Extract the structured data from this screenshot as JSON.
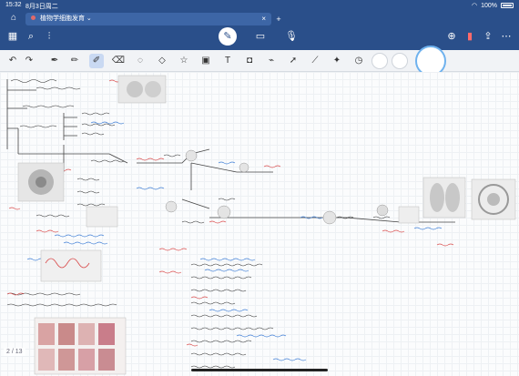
{
  "status": {
    "time": "15:32",
    "date": "8月3日周二",
    "battery": "100%"
  },
  "document": {
    "title": "植物学细胞发育",
    "page_indicator": "2 / 13"
  },
  "toolbar": {
    "left": [
      "grid-icon",
      "search-icon",
      "audio-icon"
    ],
    "center": [
      "pen-edit-icon",
      "keyboard-icon",
      "mic-icon"
    ],
    "right": [
      "add-page-icon",
      "bookmark-icon",
      "share-icon",
      "more-icon"
    ]
  },
  "pen_tools": [
    "undo-icon",
    "redo-icon",
    "pen-icon",
    "pencil-icon",
    "highlighter-icon",
    "eraser-icon",
    "lasso-icon",
    "shapes-icon",
    "sticker-icon",
    "image-icon",
    "text-icon",
    "camera-icon",
    "pointer-icon",
    "timer-icon"
  ],
  "colors": {
    "brand": "#2a4f8a",
    "ink_red": "#d94848",
    "ink_blue": "#3a7bd5",
    "ink_black": "#333333"
  }
}
